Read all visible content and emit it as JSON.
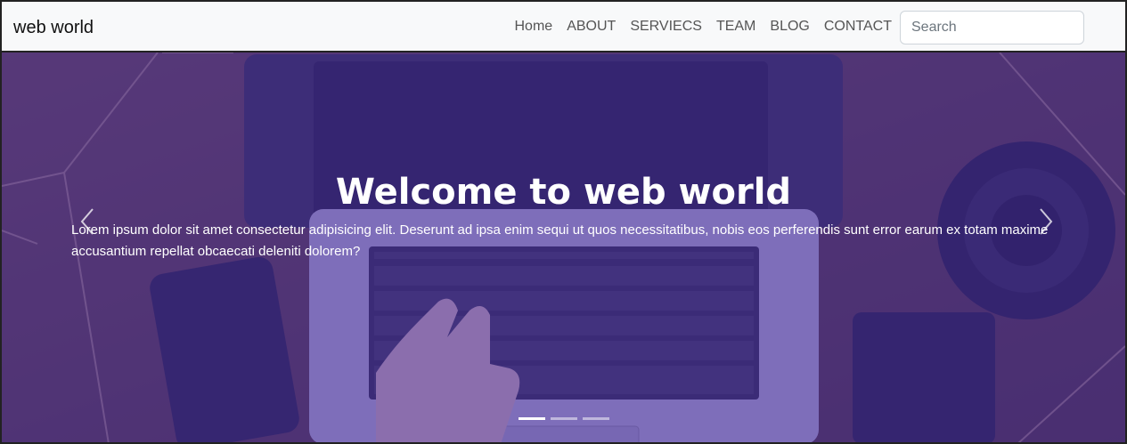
{
  "navbar": {
    "brand": "web world",
    "links": [
      "Home",
      "ABOUT",
      "SERVIECS",
      "TEAM",
      "BLOG",
      "CONTACT"
    ],
    "search_placeholder": "Search"
  },
  "hero": {
    "title": "Welcome to web world",
    "text": "Lorem ipsum dolor sit amet consectetur adipisicing elit. Deserunt ad ipsa enim sequi ut quos necessitatibus, nobis eos perferendis sunt error earum ex totam maxime accusantium repellat obcaecati deleniti dolorem?",
    "slide_count": 3,
    "active_slide": 1
  },
  "colors": {
    "overlay": "#482caa",
    "navbar_bg": "#f8f9fa"
  },
  "icons": {
    "prev": "chevron-left-icon",
    "next": "chevron-right-icon"
  }
}
